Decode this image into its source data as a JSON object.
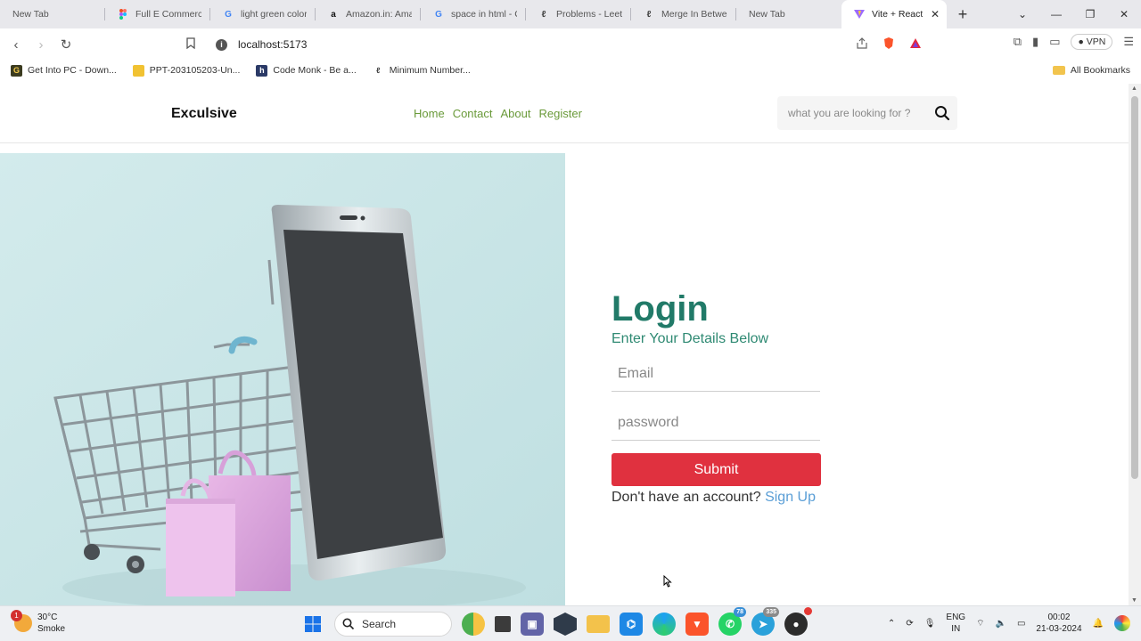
{
  "browser": {
    "tabs": [
      {
        "title": "New Tab",
        "icon": "blank-tab-icon"
      },
      {
        "title": "Full E Commerce",
        "icon": "figma-icon"
      },
      {
        "title": "light green color",
        "icon": "google-icon"
      },
      {
        "title": "Amazon.in: Amaz",
        "icon": "amazon-icon"
      },
      {
        "title": "space in html - G",
        "icon": "google-icon"
      },
      {
        "title": "Problems - LeetC",
        "icon": "leetcode-icon"
      },
      {
        "title": "Merge In Betwee",
        "icon": "leetcode-icon"
      },
      {
        "title": "New Tab",
        "icon": "blank-tab-icon"
      },
      {
        "title": "Vite + React",
        "icon": "vite-icon"
      }
    ],
    "url": "localhost:5173",
    "vpn_label": "VPN",
    "bookmarks": [
      {
        "label": "Get Into PC - Down...",
        "color": "#3b3b1f",
        "glyph": "G"
      },
      {
        "label": "PPT-203105203-Un...",
        "color": "#f1c232",
        "glyph": ""
      },
      {
        "label": "Code Monk - Be a...",
        "color": "#2b3a67",
        "glyph": "h"
      },
      {
        "label": "Minimum Number...",
        "color": "#ffffff",
        "glyph": ""
      }
    ],
    "all_bookmarks_label": "All Bookmarks"
  },
  "site": {
    "brand": "Exculsive",
    "nav": [
      "Home",
      "Contact",
      "About",
      "Register"
    ],
    "search_placeholder": "what you are looking for ?"
  },
  "login": {
    "title": "Login",
    "subtitle": "Enter Your Details Below",
    "email_placeholder": "Email",
    "password_placeholder": "password",
    "submit_label": "Submit",
    "signup_prompt": "Don't have an account?",
    "signup_link": "Sign Up"
  },
  "colors": {
    "brand_green": "#217a68",
    "nav_green": "#6a9a3a",
    "submit_red": "#e0313f",
    "link_blue": "#5a9ed6",
    "hero_bg": "#c9e4e6"
  },
  "taskbar": {
    "weather_badge": "1",
    "temperature": "30°C",
    "condition": "Smoke",
    "search_label": "Search",
    "whatsapp_badge": "78",
    "telegram_badge": "335",
    "lang_top": "ENG",
    "lang_bottom": "IN",
    "time": "00:02",
    "date": "21-03-2024"
  }
}
